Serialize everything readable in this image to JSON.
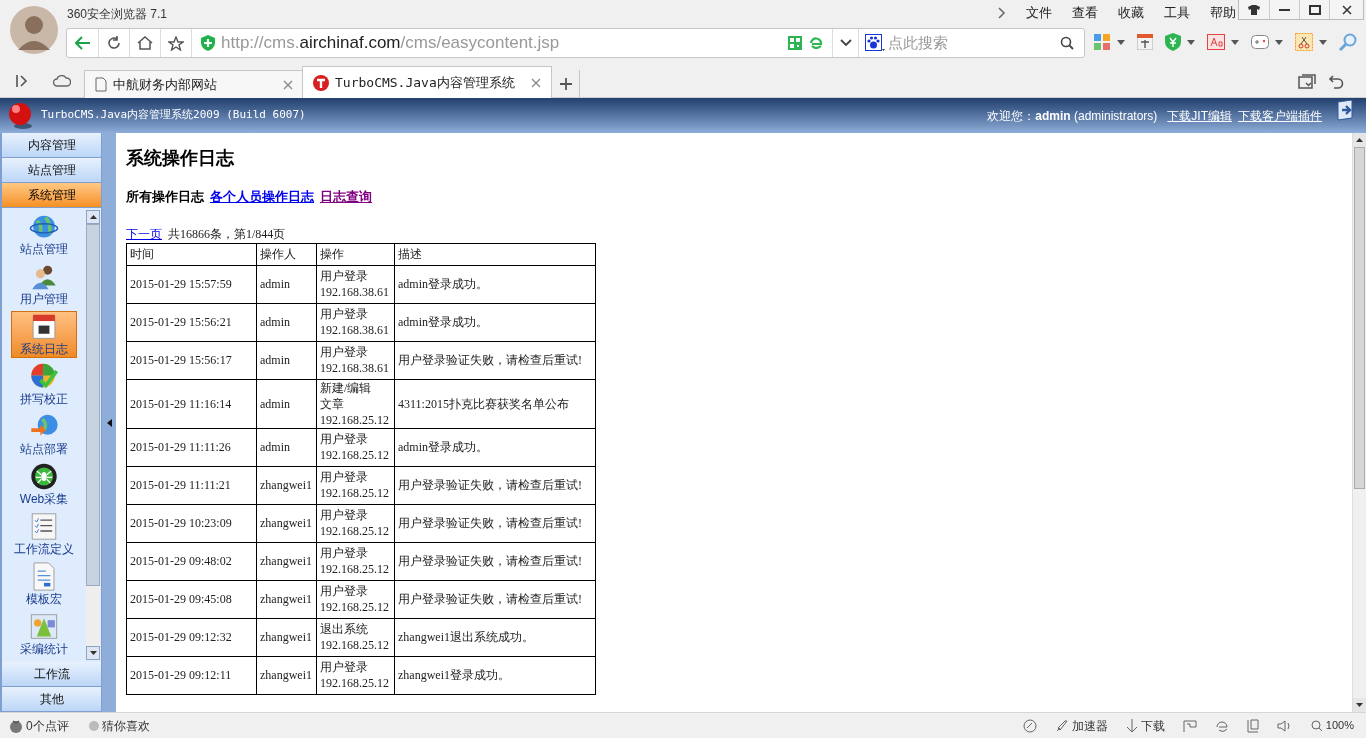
{
  "browser": {
    "title": "360安全浏览器 7.1",
    "menu": [
      "文件",
      "查看",
      "收藏",
      "工具",
      "帮助"
    ],
    "address": {
      "prefix": "http://cms.",
      "domain": "airchinaf.com",
      "suffix": "/cms/easycontent.jsp"
    },
    "search": {
      "placeholder": "点此搜索"
    },
    "tabs": [
      {
        "label": "中航财务内部网站",
        "selected": false
      },
      {
        "label": "TurboCMS.Java内容管理系统",
        "selected": true
      }
    ]
  },
  "app_header": {
    "title": "TurboCMS.Java内容管理系统2009 (Build 6007)",
    "welcome": "欢迎您：**admin** (administrators)",
    "links": [
      "下载JIT编辑",
      "下载客户端插件"
    ]
  },
  "sidebar": {
    "sections_top": [
      {
        "label": "内容管理",
        "selected": false
      },
      {
        "label": "站点管理",
        "selected": false
      },
      {
        "label": "系统管理",
        "selected": true
      }
    ],
    "items": [
      {
        "label": "站点管理",
        "kind": "globe",
        "selected": false
      },
      {
        "label": "用户管理",
        "kind": "users",
        "selected": false
      },
      {
        "label": "系统日志",
        "kind": "calendar",
        "selected": true
      },
      {
        "label": "拼写校正",
        "kind": "check",
        "selected": false
      },
      {
        "label": "站点部署",
        "kind": "deploy",
        "selected": false
      },
      {
        "label": "Web采集",
        "kind": "spider",
        "selected": false
      },
      {
        "label": "工作流定义",
        "kind": "list",
        "selected": false
      },
      {
        "label": "模板宏",
        "kind": "doc",
        "selected": false
      },
      {
        "label": "采编统计",
        "kind": "chart",
        "selected": false
      }
    ],
    "sections_bottom": [
      {
        "label": "工作流",
        "selected": false
      },
      {
        "label": "其他",
        "selected": false
      }
    ]
  },
  "page": {
    "title": "系统操作日志",
    "log_tabs": [
      {
        "label": "所有操作日志",
        "selected": true,
        "visited": false
      },
      {
        "label": "各个人员操作日志",
        "selected": false,
        "visited": false
      },
      {
        "label": "日志查询",
        "selected": false,
        "visited": true
      }
    ],
    "pager": {
      "next": "下一页",
      "summary": "共16866条，第1/844页"
    },
    "table": {
      "columns": [
        "时间",
        "操作人",
        "操作",
        "描述"
      ],
      "rows": [
        {
          "time": "2015-01-29 15:57:59",
          "user": "admin",
          "operation": "用户登录",
          "ip": "192.168.38.61",
          "description": "admin登录成功。"
        },
        {
          "time": "2015-01-29 15:56:21",
          "user": "admin",
          "operation": "用户登录",
          "ip": "192.168.38.61",
          "description": "admin登录成功。"
        },
        {
          "time": "2015-01-29 15:56:17",
          "user": "admin",
          "operation": "用户登录",
          "ip": "192.168.38.61",
          "description": "用户登录验证失败，请检查后重试!"
        },
        {
          "time": "2015-01-29 11:16:14",
          "user": "admin",
          "operation": "新建/编辑文章",
          "ip": "192.168.25.12",
          "description": "4311:2015扑克比赛获奖名单公布"
        },
        {
          "time": "2015-01-29 11:11:26",
          "user": "admin",
          "operation": "用户登录",
          "ip": "192.168.25.12",
          "description": "admin登录成功。"
        },
        {
          "time": "2015-01-29 11:11:21",
          "user": "zhangwei1",
          "operation": "用户登录",
          "ip": "192.168.25.12",
          "description": "用户登录验证失败，请检查后重试!"
        },
        {
          "time": "2015-01-29 10:23:09",
          "user": "zhangwei1",
          "operation": "用户登录",
          "ip": "192.168.25.12",
          "description": "用户登录验证失败，请检查后重试!"
        },
        {
          "time": "2015-01-29 09:48:02",
          "user": "zhangwei1",
          "operation": "用户登录",
          "ip": "192.168.25.12",
          "description": "用户登录验证失败，请检查后重试!"
        },
        {
          "time": "2015-01-29 09:45:08",
          "user": "zhangwei1",
          "operation": "用户登录",
          "ip": "192.168.25.12",
          "description": "用户登录验证失败，请检查后重试!"
        },
        {
          "time": "2015-01-29 09:12:32",
          "user": "zhangwei1",
          "operation": "退出系统",
          "ip": "192.168.25.12",
          "description": "zhangwei1退出系统成功。"
        },
        {
          "time": "2015-01-29 09:12:11",
          "user": "zhangwei1",
          "operation": "用户登录",
          "ip": "192.168.25.12",
          "description": "zhangwei1登录成功。"
        }
      ]
    }
  },
  "status_bar": {
    "left": [
      "0个点评",
      "猜你喜欢"
    ],
    "accelerator": "加速器",
    "download": "下载",
    "zoom": "100%"
  }
}
